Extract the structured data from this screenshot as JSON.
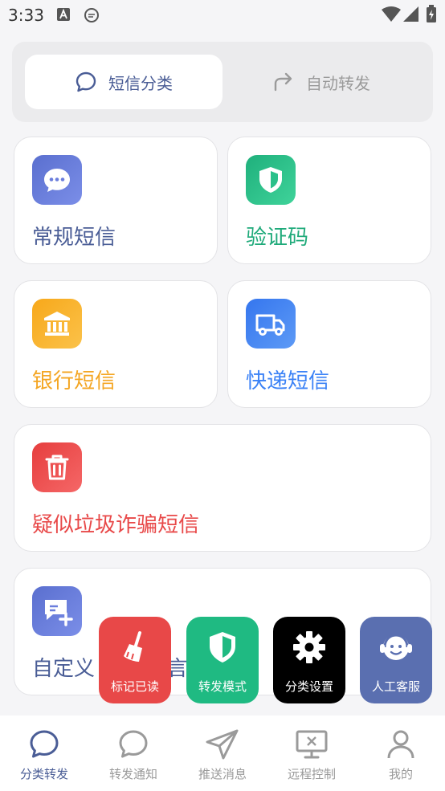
{
  "status_bar": {
    "time": "3:33"
  },
  "segment": {
    "tabs": [
      {
        "label": "短信分类"
      },
      {
        "label": "自动转发"
      }
    ]
  },
  "categories": [
    {
      "label": "常规短信",
      "color": "#4a5d96"
    },
    {
      "label": "验证码",
      "color": "#1faa7a"
    },
    {
      "label": "银行短信",
      "color": "#f4a623"
    },
    {
      "label": "快递短信",
      "color": "#3b82f6"
    },
    {
      "label": "疑似垃圾诈骗短信",
      "color": "#e84848"
    },
    {
      "label": "自定义",
      "label_tail": "言",
      "color": "#4a5d96"
    }
  ],
  "fab_menu": [
    {
      "label": "标记已读",
      "color": "#e84848"
    },
    {
      "label": "转发模式",
      "color": "#1fba82"
    },
    {
      "label": "分类设置",
      "color": "#000000"
    },
    {
      "label": "人工客服",
      "color": "#5a6fb0"
    }
  ],
  "bottom_nav": {
    "items": [
      {
        "label": "分类转发",
        "active": true
      },
      {
        "label": "转发通知"
      },
      {
        "label": "推送消息"
      },
      {
        "label": "远程控制"
      },
      {
        "label": "我的"
      }
    ]
  }
}
